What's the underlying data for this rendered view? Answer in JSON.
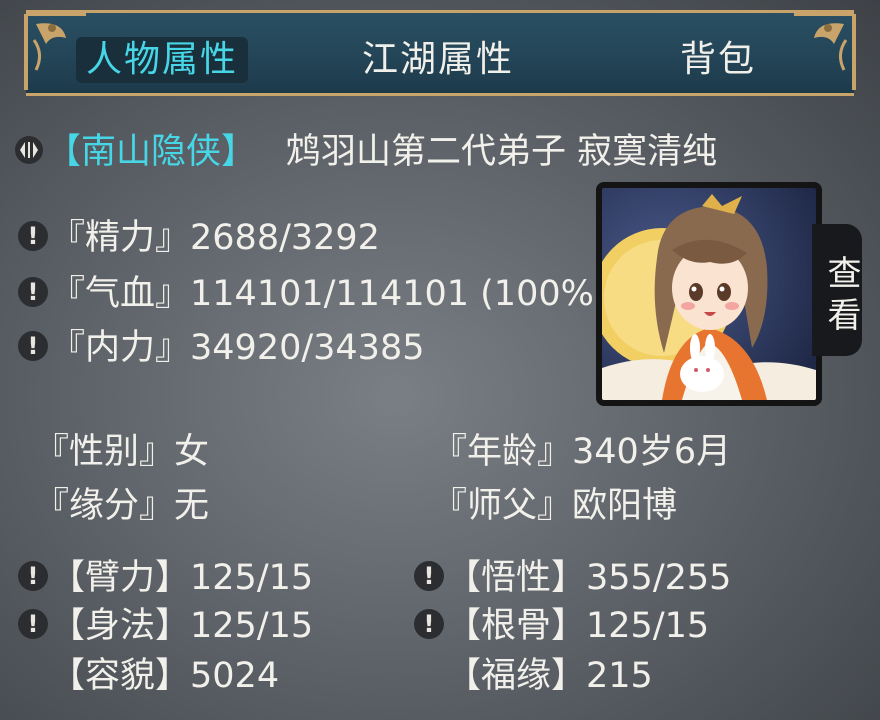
{
  "tabs": [
    {
      "label": "人物属性",
      "active": true
    },
    {
      "label": "江湖属性",
      "active": false
    },
    {
      "label": "背包",
      "active": false
    }
  ],
  "character": {
    "title": "【南山隐侠】",
    "description": "鸩羽山第二代弟子 寂寞清纯"
  },
  "vitals": [
    {
      "label": "『精力』",
      "value": "2688/3292"
    },
    {
      "label": "『气血』",
      "value": "114101/114101 (100%"
    },
    {
      "label": "『内力』",
      "value": "34920/34385"
    }
  ],
  "profile": {
    "gender_label": "『性别』",
    "gender": "女",
    "age_label": "『年龄』",
    "age": "340岁6月",
    "fate_label": "『缘分』",
    "fate": "无",
    "master_label": "『师父』",
    "master": "欧阳博"
  },
  "attributes": {
    "strength_label": "【臂力】",
    "strength": "125/15",
    "insight_label": "【悟性】",
    "insight": "355/255",
    "agility_label": "【身法】",
    "agility": "125/15",
    "constitution_label": "【根骨】",
    "constitution": "125/15",
    "looks_label": "【容貌】",
    "looks": "5024",
    "luck_label": "【福缘】",
    "luck": "215"
  },
  "view_button": "查看",
  "warning_glyph": "!",
  "colors": {
    "accent": "#47d6e6",
    "topbar": "#234456",
    "gold": "#c9a46a"
  }
}
